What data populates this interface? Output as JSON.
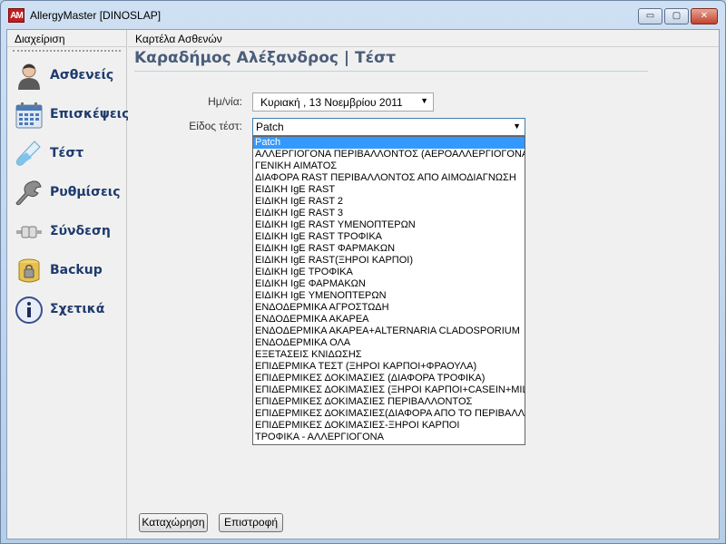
{
  "window": {
    "app_icon_text": "AM",
    "title": "AllergyMaster [DINOSLAP]",
    "controls": {
      "minimize": "▭",
      "maximize": "▢",
      "close": "✕"
    }
  },
  "sidebar": {
    "header": "Διαχείριση",
    "items": [
      {
        "label": "Ασθενείς",
        "icon": "patient-icon"
      },
      {
        "label": "Επισκέψεις",
        "icon": "calendar-icon"
      },
      {
        "label": "Τέστ",
        "icon": "test-tube-icon"
      },
      {
        "label": "Ρυθμίσεις",
        "icon": "wrench-icon"
      },
      {
        "label": "Σύνδεση",
        "icon": "plug-icon"
      },
      {
        "label": "Backup",
        "icon": "backup-icon"
      },
      {
        "label": "Σχετικά",
        "icon": "info-icon"
      }
    ]
  },
  "main": {
    "header": "Καρτέλα Ασθενών",
    "patient_title": "Καραδήμος Αλέξανδρος | Τέστ",
    "date_label": "Ημ/νία:",
    "date_value": "Κυριακή  , 13  Νοεμβρίου  2011",
    "test_type_label": "Είδος τέστ:",
    "test_type_value": "Patch",
    "dropdown_options": [
      "Patch",
      "ΑΛΛΕΡΓΙΟΓΟΝΑ ΠΕΡΙΒΑΛΛΟΝΤΟΣ (ΑΕΡΟΑΛΛΕΡΓΙΟΓΟΝΑ)",
      "ΓΕΝΙΚΗ ΑΙΜΑΤΟΣ",
      "ΔΙΑΦΟΡΑ RAST ΠΕΡΙΒΑΛΛΟΝΤΟΣ ΑΠΟ ΑΙΜΟΔΙΑΓΝΩΣΗ",
      "ΕΙΔΙΚΗ IgE RAST",
      "ΕΙΔΙΚΗ IgE RAST 2",
      "ΕΙΔΙΚΗ IgE RAST 3",
      "ΕΙΔΙΚΗ IgE RAST ΥΜΕΝΟΠΤΕΡΩΝ",
      "ΕΙΔΙΚΗ IgE RAST ΤΡΟΦΙΚΑ",
      "ΕΙΔΙΚΗ IgE RAST ΦΑΡΜΑΚΩΝ",
      "ΕΙΔΙΚΗ IgE RAST(ΞΗΡΟΙ ΚΑΡΠΟΙ)",
      "ΕΙΔΙΚΗ IgE ΤΡΟΦΙΚΑ",
      "ΕΙΔΙΚΗ IgE ΦΑΡΜΑΚΩΝ",
      "ΕΙΔΙΚΗ IgE ΥΜΕΝΟΠΤΕΡΩΝ",
      "ΕΝΔΟΔΕΡΜΙΚΑ ΑΓΡΟΣΤΩΔΗ",
      "ΕΝΔΟΔΕΡΜΙΚΑ ΑΚΑΡΕΑ",
      "ΕΝΔΟΔΕΡΜΙΚΑ ΑΚΑΡΕΑ+ALTERNARIA CLADOSPORIUM",
      "ΕΝΔΟΔΕΡΜΙΚΑ ΟΛΑ",
      "ΕΞΕΤΑΣΕΙΣ ΚΝΙΔΩΣΗΣ",
      "ΕΠΙΔΕΡΜΙΚΑ ΤΕΣΤ (ΞΗΡΟΙ ΚΑΡΠΟΙ+ΦΡΑΟΥΛΑ)",
      "ΕΠΙΔΕΡΜΙΚΕΣ ΔΟΚΙΜΑΣΙΕΣ (ΔΙΑΦΟΡΑ ΤΡΟΦΙΚΑ)",
      "ΕΠΙΔΕΡΜΙΚΕΣ ΔΟΚΙΜΑΣΙΕΣ (ΞΗΡΟΙ ΚΑΡΠΟΙ+CASEIN+MILK)",
      "ΕΠΙΔΕΡΜΙΚΕΣ ΔΟΚΙΜΑΣΙΕΣ ΠΕΡΙΒΑΛΛΟΝΤΟΣ",
      "ΕΠΙΔΕΡΜΙΚΕΣ ΔΟΚΙΜΑΣΙΕΣ(ΔΙΑΦΟΡΑ ΑΠΟ ΤΟ ΠΕΡΙΒΑΛΛΟΝΤ",
      "ΕΠΙΔΕΡΜΙΚΕΣ ΔΟΚΙΜΑΣΙΕΣ-ΞΗΡΟΙ ΚΑΡΠΟΙ",
      "ΤΡΟΦΙΚΑ - ΑΛΛΕΡΓΙΟΓΟΝΑ"
    ],
    "save_button": "Καταχώρηση",
    "back_button": "Επιστροφή"
  }
}
